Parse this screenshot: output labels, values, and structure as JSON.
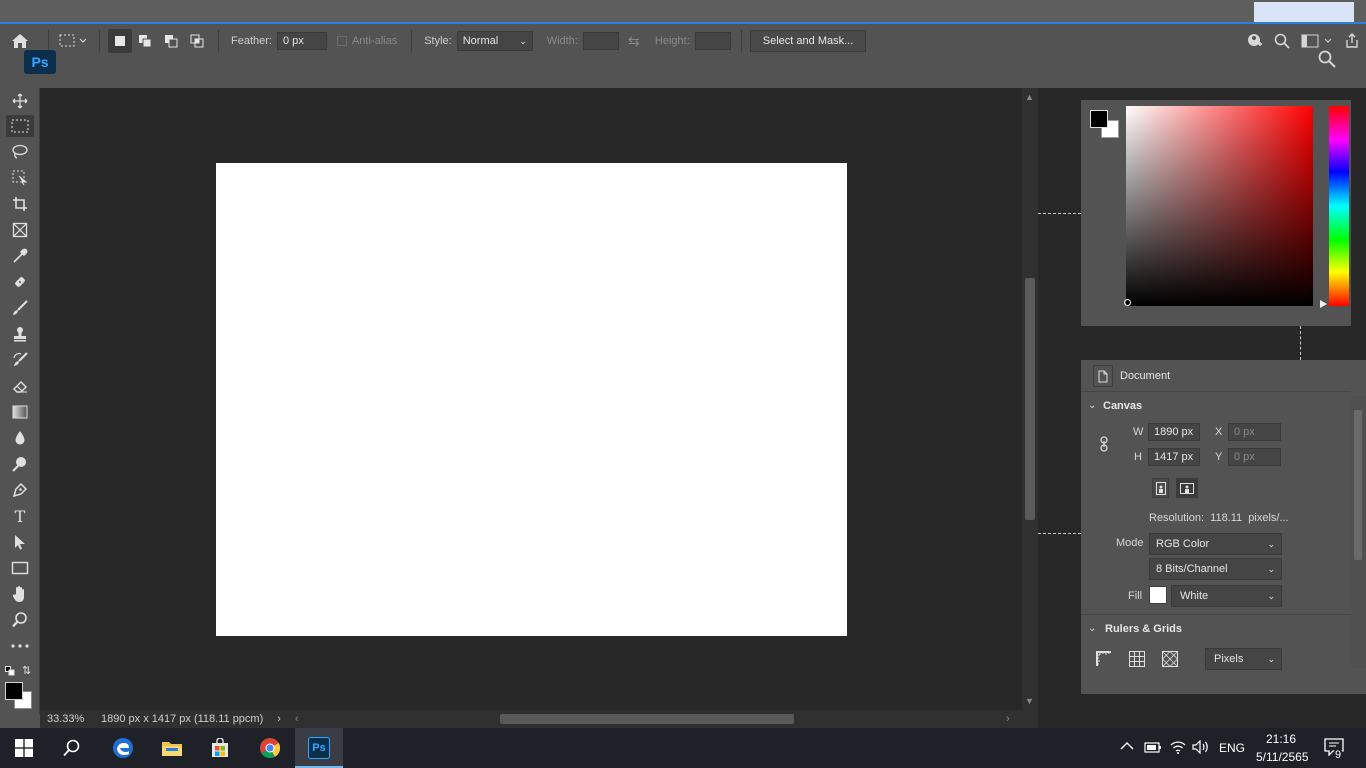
{
  "options_bar": {
    "feather_label": "Feather:",
    "feather_value": "0 px",
    "antialias_label": "Anti-alias",
    "style_label": "Style:",
    "style_value": "Normal",
    "width_label": "Width:",
    "height_label": "Height:",
    "select_mask_label": "Select and Mask..."
  },
  "app_logo": "Ps",
  "tools": [
    "move-tool",
    "marquee-tool",
    "lasso-tool",
    "object-select-tool",
    "crop-tool",
    "frame-tool",
    "eyedropper-tool",
    "healing-tool",
    "brush-tool",
    "stamp-tool",
    "history-brush-tool",
    "eraser-tool",
    "gradient-tool",
    "blur-tool",
    "dodge-tool",
    "pen-tool",
    "type-tool",
    "path-select-tool",
    "rectangle-tool",
    "hand-tool",
    "zoom-tool",
    "more-tools"
  ],
  "type_tool_glyph": "T",
  "status": {
    "zoom": "33.33%",
    "doc_info": "1890 px x 1417 px (118.11 ppcm)"
  },
  "properties": {
    "header": "Document",
    "canvas_section": "Canvas",
    "w_label": "W",
    "w_value": "1890 px",
    "h_label": "H",
    "h_value": "1417 px",
    "x_label": "X",
    "x_value": "0 px",
    "y_label": "Y",
    "y_value": "0 px",
    "resolution": "Resolution:  118.11  pixels/...",
    "mode_label": "Mode",
    "mode_value": "RGB Color",
    "bits_value": "8 Bits/Channel",
    "fill_label": "Fill",
    "fill_value": "White",
    "rulers_section": "Rulers & Grids",
    "units_value": "Pixels"
  },
  "taskbar": {
    "language": "ENG",
    "time": "21:16",
    "date": "5/11/2565",
    "notification_count": "9"
  },
  "colors": {
    "foreground": "#000000",
    "background": "#ffffff",
    "accent": "#2b7fe0"
  }
}
